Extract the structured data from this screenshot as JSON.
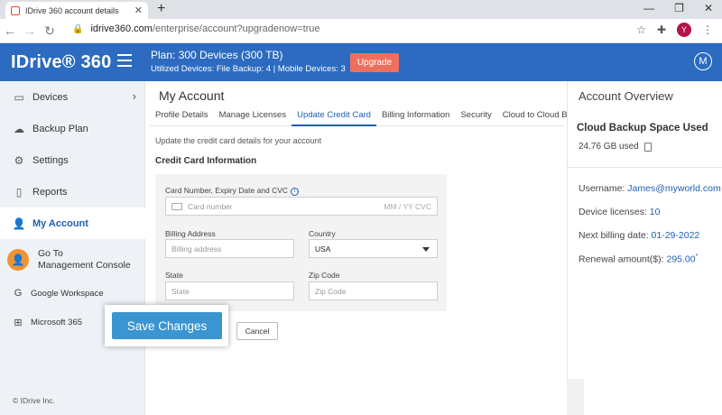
{
  "browser": {
    "tab_title": "IDrive 360 account details",
    "url_domain": "idrive360.com",
    "url_path": "/enterprise/account?upgradenow=true",
    "profile_letter": "Y"
  },
  "header": {
    "logo": "IDrive® 360",
    "plan": "Plan: 300 Devices (300 TB)",
    "utilized": "Utilized Devices: File Backup: 4 |  Mobile Devices: 3",
    "upgrade_label": "Upgrade",
    "user_initial": "M"
  },
  "sidebar": {
    "items": [
      {
        "label": "Devices",
        "icon": "devices-icon"
      },
      {
        "label": "Backup Plan",
        "icon": "cloud-upload-icon"
      },
      {
        "label": "Settings",
        "icon": "gear-icon"
      },
      {
        "label": "Reports",
        "icon": "document-icon"
      },
      {
        "label": "My Account",
        "icon": "user-icon"
      }
    ],
    "goto_line1": "Go To",
    "goto_line2": "Management Console",
    "google": "Google Workspace",
    "microsoft": "Microsoft 365",
    "copyright": "© IDrive Inc."
  },
  "main": {
    "title": "My Account",
    "tabs": [
      "Profile Details",
      "Manage Licenses",
      "Update Credit Card",
      "Billing Information",
      "Security",
      "Cloud to Cloud Backup"
    ],
    "description": "Update the credit card details for your account",
    "section_title": "Credit Card Information",
    "card_label": "Card Number, Expiry Date and CVC",
    "card_placeholder": "Card number",
    "card_mm": "MM / YY  CVC",
    "billing_label": "Billing Address",
    "billing_placeholder": "Billing address",
    "country_label": "Country",
    "country_value": "USA",
    "state_label": "State",
    "state_placeholder": "State",
    "zip_label": "Zip Code",
    "zip_placeholder": "Zip Code",
    "save_label": "Save Changes",
    "cancel_label": "Cancel"
  },
  "overview": {
    "title": "Account Overview",
    "space_heading": "Cloud  Backup Space Used",
    "space_used": "24.76 GB used",
    "username_label": "Username: ",
    "username": "James@myworld.com",
    "licenses_label": "Device licenses: ",
    "licenses": "10",
    "billing_label": "Next billing date: ",
    "billing_date": "01-29-2022",
    "renewal_label": "Renewal amount($): ",
    "renewal": "295.00",
    "renewal_mark": "*"
  }
}
